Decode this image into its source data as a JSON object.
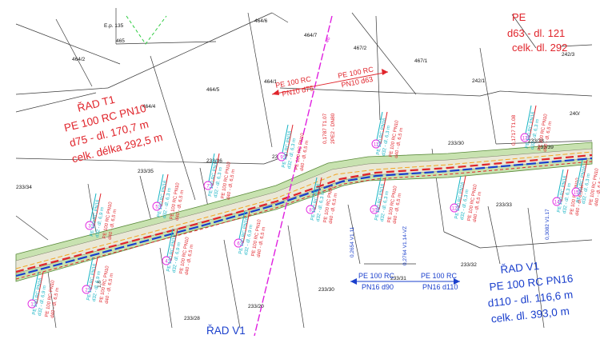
{
  "parcels": [
    "E.p. 135",
    "465",
    "464/6",
    "464/7",
    "467/2",
    "467/1",
    "464/2",
    "464/1",
    "464/5",
    "464/4",
    "233/35",
    "233/36",
    "233/37",
    "233/30",
    "233/34",
    "233/38",
    "233/39",
    "242/1",
    "242/3",
    "240/",
    "233/33",
    "233/32",
    "233/31",
    "233/20",
    "233/28",
    "233/30"
  ],
  "notes": {
    "t1_line1": "ŘAD T1",
    "t1_line2": "PE 100 RC PN10",
    "t1_line3": "d75 - dl. 170,7 m",
    "t1_line4": "celk. délka 292,5 m",
    "d63_line1": "d63 - dl. 121",
    "d63_line2": "celk. dl. 292",
    "pe_top": "PE",
    "arrow_left_top": "PE 100 RC",
    "arrow_left_bottom": "PN10 d75",
    "arrow_right_top": "PE 100 RC",
    "arrow_right_bottom": "PN10 d63",
    "v1_line1": "ŘAD V1",
    "v1_line2": "PE 100 RC PN16",
    "v1_line3": "d110 - dl. 116,6 m",
    "v1_line4": "celk. dl. 393,0 m",
    "v1_bottom": "ŘAD V1",
    "blue_left_top": "PE 100 RC",
    "blue_left_bottom": "PN16 d90",
    "blue_right_top": "PE 100 RC",
    "blue_right_bottom": "PN16 d110",
    "v1_ch1": "0,2654 V1.11",
    "v1_ch2": "0,2764 V1.14-VZ",
    "v1_ch3": "0,3082 V1.17",
    "t1_ch1": "0,1787 T1.07",
    "t1_ch2": "0,1717 T1.08",
    "dn_note": "2PE2 - DN80",
    "tag_46": "46",
    "crossing": "1,8"
  },
  "branch_labels": [
    {
      "num": "1",
      "cyan": "PE 100 RC PN16\nd32 - dl. 6,9 m",
      "red": "PE 100 RC PN10\nd40 - dl. 6,5 m"
    },
    {
      "num": "2",
      "cyan": "PE 100 RC PN16\nd32 - dl. 6,9 m",
      "red": "PE 100 RC PN10\nd40 - dl. 6,5 m"
    },
    {
      "num": "3",
      "cyan": "PE 100 RC PN16\nd32 - dl. 6,9 m",
      "red": "PE 100 RC PN10\nd40 - dl. 6,5 m"
    },
    {
      "num": "4",
      "cyan": "PE 100 RC PN16\nd32 - dl. 6,9 m",
      "red": "PE 100 RC PN10\nd40 - dl. 6,5 m"
    },
    {
      "num": "5",
      "cyan": "PE 100 RC PN16\nd32 - dl. 6,3 m",
      "red": "PE 100 RC PN10\nd40 - dl. 6,5 m"
    },
    {
      "num": "6",
      "cyan": "PE 100 RC PN16\nd32 - dl. 6,9 m",
      "red": "PE 100 RC PN10\nd40 - dl. 6,5 m"
    },
    {
      "num": "7",
      "cyan": "PE 100 RC PN16\nd32 - dl. 6,3 m",
      "red": "PE 100 RC PN10\nd40 - dl. 6,5 m"
    },
    {
      "num": "8",
      "cyan": "PE 100 RC PN16\nd32 - dl. 6,3 m",
      "red": "PE 100 RC PN10\nd40 - dl. 6,5 m"
    },
    {
      "num": "9",
      "cyan": "PE 100 RC PN16\nd32 - dl. 6,3 m",
      "red": "PE 100 RC PN10\nd40 - dl. 6,5 m"
    },
    {
      "num": "10",
      "cyan": "PE 100 RC PN16\nd32 - dl. 6,3 m",
      "red": "PE 100 RC PN10\nd40 - dl. 6,5 m"
    },
    {
      "num": "11",
      "cyan": "PE 100 RC PN16\nd32 - dl. 6,3 m",
      "red": "PE 100 RC PN10\nd40 - dl. 6,5 m"
    },
    {
      "num": "12",
      "cyan": "PE 100 RC PN16\nd32 - dl. 6,3 m",
      "red": "PE 100 RC PN10\nd40 - dl. 6,5 m"
    },
    {
      "num": "13",
      "cyan": "PE 100 RC PN16\nd32 - dl. 6,3 m",
      "red": "PE 100 RC PN10\nd40 - dl. 6,5 m"
    },
    {
      "num": "14",
      "cyan": "PE 100 RC PN16\nd32 - dl. 6,3 m",
      "red": "PE 100 RC PN10\nd40 - dl. 6,5 m"
    },
    {
      "num": "15",
      "cyan": "PE 100 RC PN16\nd32 - dl. 6,3 m",
      "red": "PE 100 RC PN10\nd40 - dl. 6,5 m"
    }
  ],
  "colors": {
    "water": "#1a3fcc",
    "sewer": "#e0242b",
    "branch_cyan": "#16b3c4",
    "road_fill": "#c8e2b0",
    "magenta": "#e020e0",
    "parcel_line": "#3a3a3a"
  }
}
